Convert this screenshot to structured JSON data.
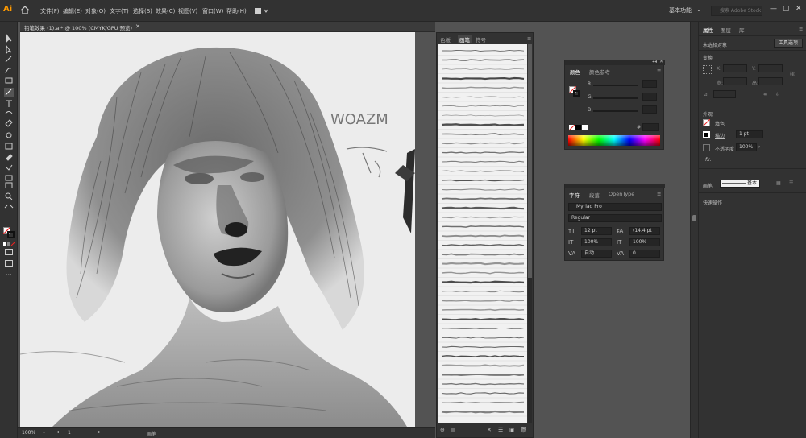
{
  "app": {
    "logo": "Ai",
    "workspace": "基本功能",
    "search_placeholder": "搜索 Adobe Stock"
  },
  "menu": [
    "文件(F)",
    "编辑(E)",
    "对象(O)",
    "文字(T)",
    "选择(S)",
    "效果(C)",
    "视图(V)",
    "窗口(W)",
    "帮助(H)"
  ],
  "document": {
    "tab_title": "铅笔效果 (1).ai* @ 100% (CMYK/GPU 预览)",
    "zoom": "100%",
    "artboard_num": "1",
    "status_tool": "画笔",
    "annotation": "WOAZM"
  },
  "brush_panel": {
    "tabs": [
      "色板",
      "画笔",
      "符号"
    ],
    "active": "画笔"
  },
  "color_panel": {
    "tabs": [
      "颜色",
      "颜色参考"
    ],
    "channels": [
      "R",
      "G",
      "B"
    ],
    "hex_symbol": "#"
  },
  "char_panel": {
    "tabs": [
      "字符",
      "段落",
      "OpenType"
    ],
    "font": "Myriad Pro",
    "style": "Regular",
    "size": "12 pt",
    "leading": "(14.4 pt",
    "vscale": "100%",
    "hscale": "100%",
    "kerning": "自动",
    "tracking": "0"
  },
  "properties": {
    "tabs": [
      "属性",
      "图层",
      "库"
    ],
    "no_selection": "未选择对象",
    "quick_btn": "工具选项",
    "transform_title": "变换",
    "transform_labels": [
      "X:",
      "Y:",
      "宽:",
      "高:"
    ],
    "appearance_title": "外观",
    "fill_label": "填色",
    "stroke_label": "描边",
    "stroke_value": "1 pt",
    "opacity_label": "不透明度",
    "opacity_value": "100%",
    "fx_label": "fx.",
    "brush_label": "画笔",
    "brush_value": "基本",
    "quick_actions": "快速操作"
  },
  "colors": {
    "accent": "#ff9a00",
    "ui_dark": "#323232",
    "workspace": "#535353"
  }
}
